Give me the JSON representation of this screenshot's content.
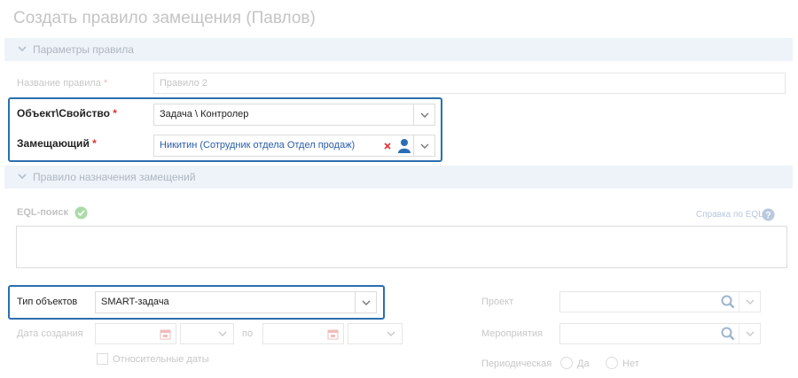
{
  "page": {
    "title": "Создать правило замещения (Павлов)"
  },
  "section_rule_params": {
    "header": "Параметры правила",
    "rule_name_label": "Название правила",
    "required_mark": "*",
    "rule_name_value": "Правило 2",
    "object_label": "Объект\\Свойство",
    "object_value": "Задача \\ Контролер",
    "substitute_label": "Замещающий",
    "substitute_value": "Никитин (Сотрудник отдела Отдел продаж)"
  },
  "section_assignment": {
    "header": "Правило назначения замещений",
    "eql_label": "EQL-поиск",
    "eql_help": "Справка по EQL",
    "object_type_label": "Тип объектов",
    "object_type_value": "SMART-задача",
    "created_date_label": "Дата создания",
    "date_to_label": "по",
    "relative_dates_label": "Относительные даты",
    "project_label": "Проект",
    "event_label": "Мероприятия",
    "periodic_label": "Периодическая",
    "yes_label": "Да",
    "no_label": "Нет"
  },
  "colors": {
    "accent_border": "#2b6fae",
    "link_blue": "#2a5ca8",
    "required_red": "#e03030",
    "ok_green": "#7dc67a"
  }
}
